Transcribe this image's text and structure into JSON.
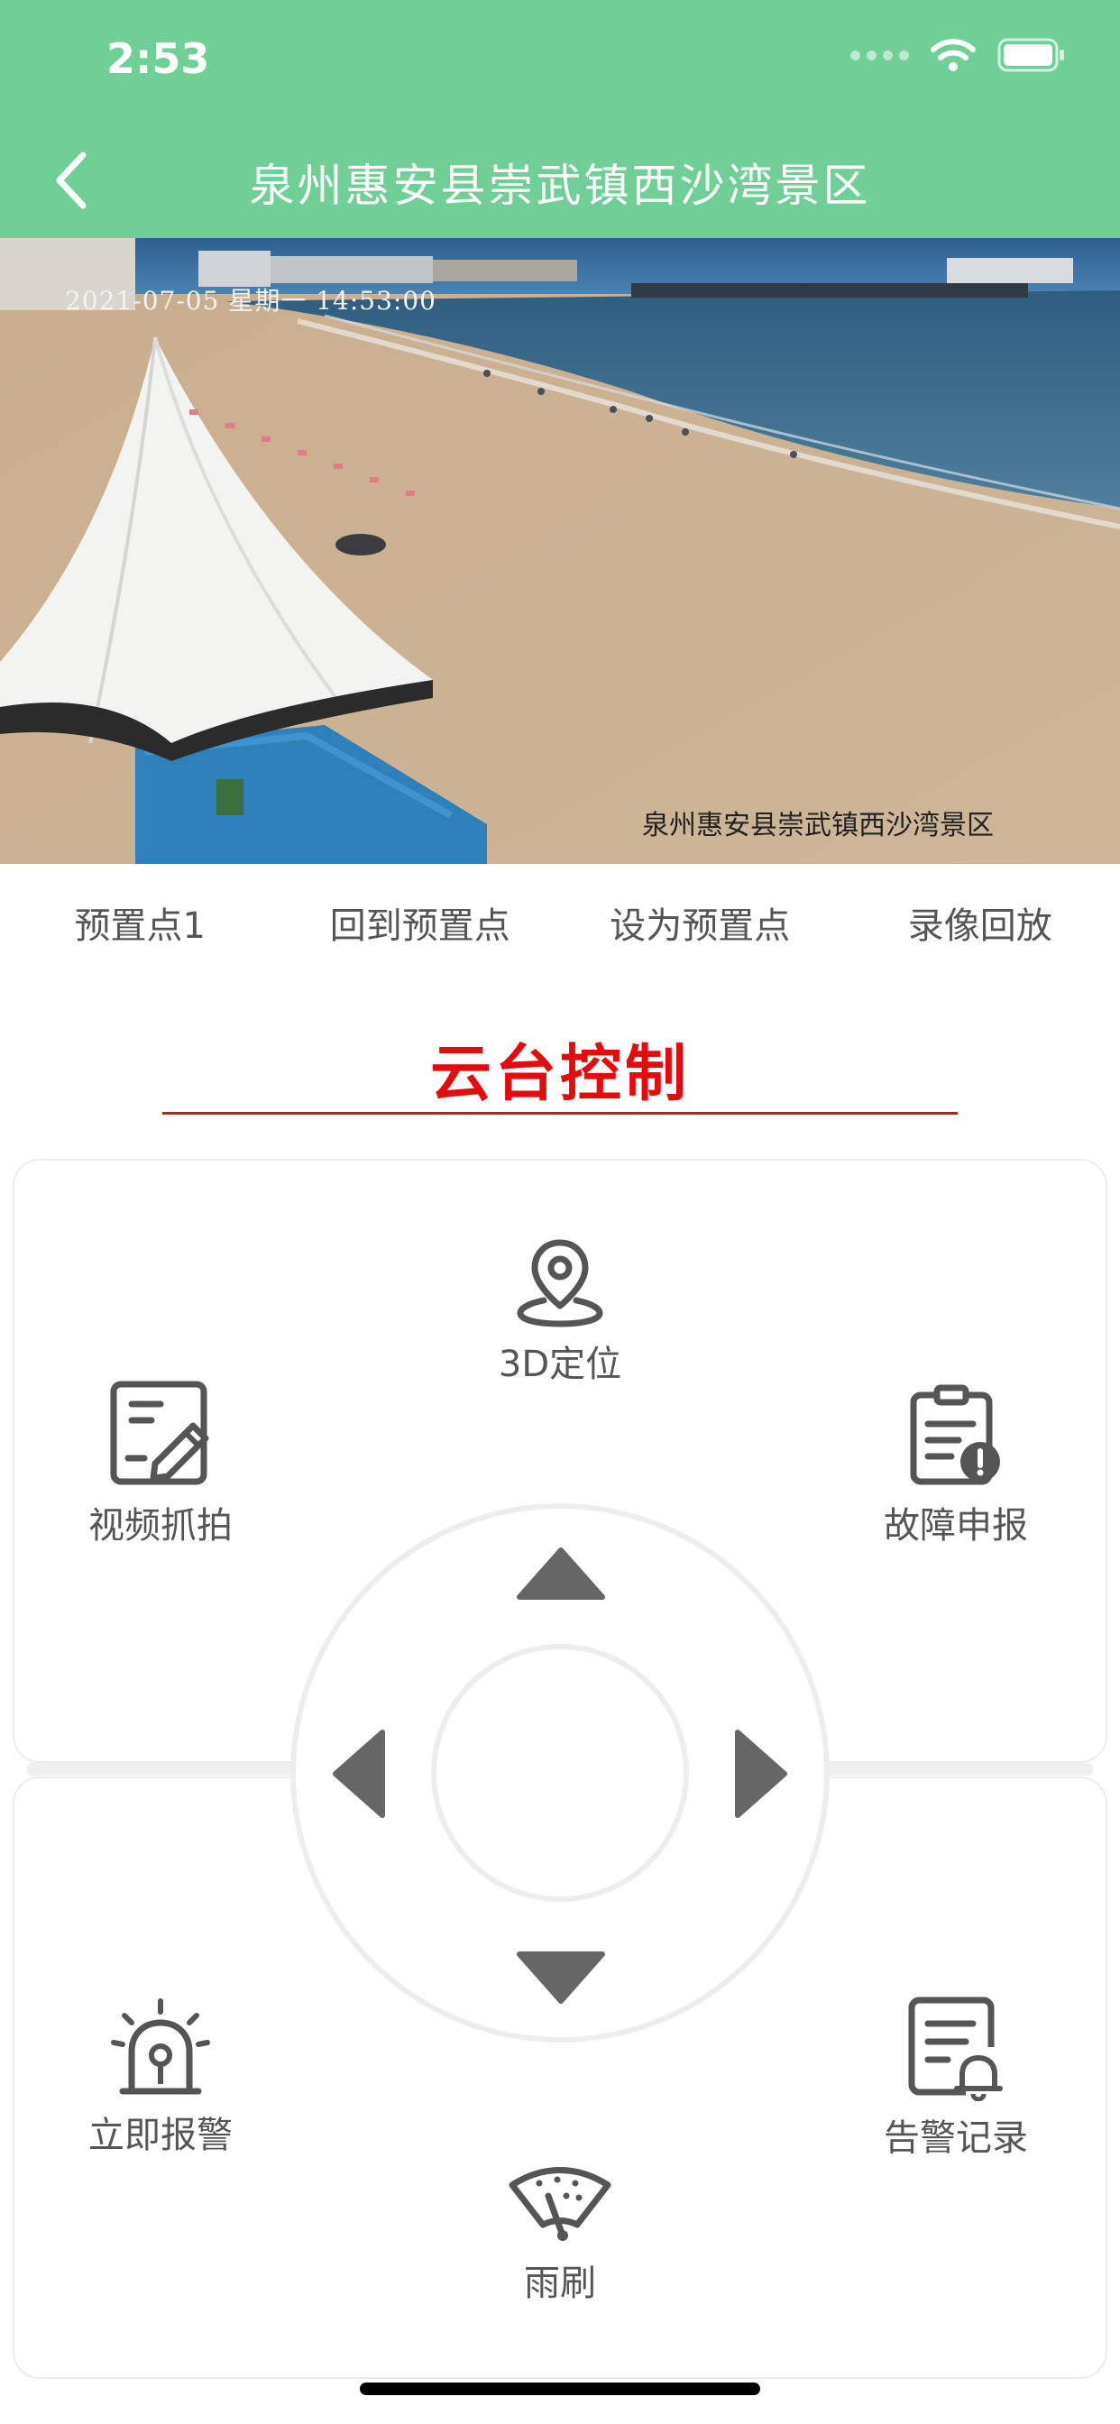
{
  "status": {
    "time": "2:53"
  },
  "header": {
    "title": "泉州惠安县崇武镇西沙湾景区",
    "bg_color": "#6fcf97",
    "back_icon": "chevron-left-icon"
  },
  "video": {
    "timestamp_overlay": "2021-07-05 星期一 14:53:00",
    "caption_overlay": "泉州惠安县崇武镇西沙湾景区"
  },
  "actions": [
    {
      "label": "预置点1"
    },
    {
      "label": "回到预置点"
    },
    {
      "label": "设为预置点"
    },
    {
      "label": "录像回放"
    }
  ],
  "ptz": {
    "title": "云台控制",
    "accent_color": "#e30b0b",
    "tools": {
      "locate_3d": {
        "label": "3D定位",
        "icon": "map-pin-icon"
      },
      "snapshot": {
        "label": "视频抓拍",
        "icon": "edit-document-icon"
      },
      "fault_report": {
        "label": "故障申报",
        "icon": "clipboard-alert-icon"
      },
      "alarm_now": {
        "label": "立即报警",
        "icon": "siren-icon"
      },
      "alarm_log": {
        "label": "告警记录",
        "icon": "document-bell-icon"
      },
      "wiper": {
        "label": "雨刷",
        "icon": "wiper-icon"
      }
    },
    "direction_pad": [
      "up",
      "down",
      "left",
      "right"
    ]
  }
}
